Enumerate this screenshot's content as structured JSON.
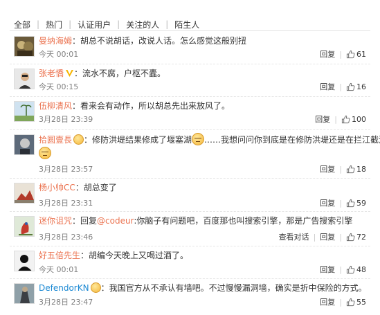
{
  "filters": [
    "全部",
    "热门",
    "认证用户",
    "关注的人",
    "陌生人"
  ],
  "actions": {
    "reply": "回复",
    "conversation": "查看对话"
  },
  "comments": [
    {
      "name": "曼纳海姆",
      "text": "：胡总不说胡话，改说人话。怎么感觉这般别扭",
      "time": "今天 00:01",
      "likes": "61"
    },
    {
      "name": "张老憍",
      "text": "：流水不腐，户枢不蠹。",
      "time": "今天 00:15",
      "likes": "16"
    },
    {
      "name": "伍柳清风",
      "text": "：看来会有动作，所以胡总先出来放风了。",
      "time": "3月28日 23:39",
      "likes": "100"
    },
    {
      "name": "拾圆壹長",
      "text_a": "：修防洪堤结果修成了堰塞湖",
      "text_b": "……我想问问你到底是在修防洪堤还是在拦江截流",
      "time": "3月28日 23:57",
      "likes": "18"
    },
    {
      "name": "杨小帅CC",
      "text": "：胡总变了",
      "time": "3月28日 23:31",
      "likes": "59"
    },
    {
      "name": "迷你诅咒",
      "text_a": "：回复",
      "mention": "@codeur",
      "text_b": ":你脑子有问题吧，百度那也叫搜索引擎，那是广告搜索引擎",
      "time": "3月28日 23:46",
      "likes": "72"
    },
    {
      "name": "好五倍先生",
      "text": "：胡编今天晚上又喝过酒了。",
      "time": "今天 00:01",
      "likes": "48"
    },
    {
      "name": "DefendorKN",
      "text": "：我国官方从不承认有墙吧。不过慢慢漏洞墙，确实是折中保险的方式。",
      "time": "3月28日 23:47",
      "likes": "55"
    }
  ],
  "colors": {
    "name": "#eb7350",
    "link": "#1a88d3",
    "meta": "#808080"
  }
}
